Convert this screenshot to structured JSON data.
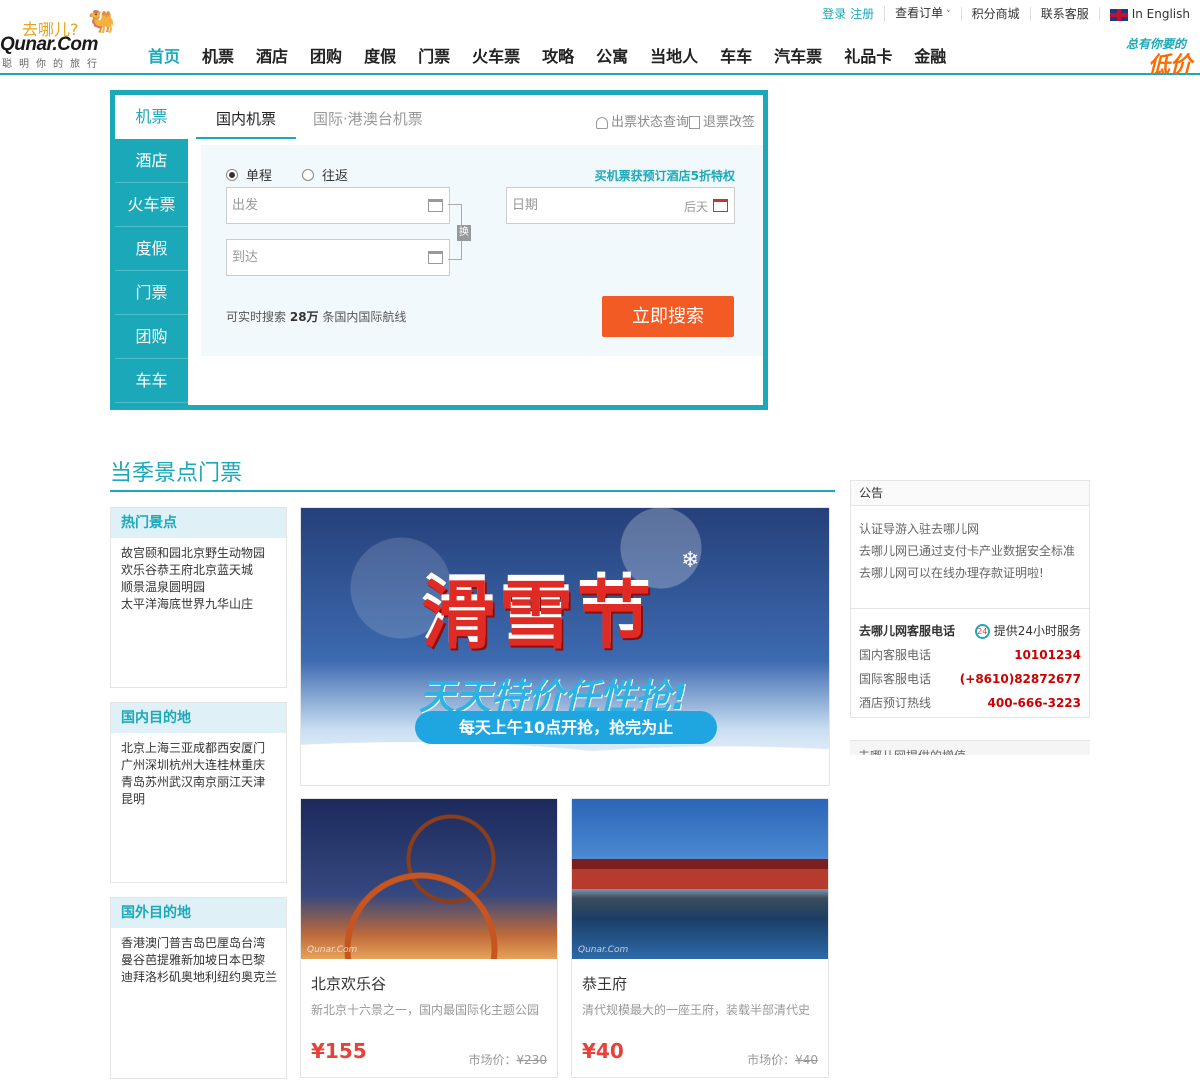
{
  "brand": {
    "logo_cn": "去哪儿?",
    "logo_en": "Qunar.Com",
    "slogan": "聪明你的旅行",
    "promo_line1": "总有你要的",
    "promo_line2": "低价"
  },
  "topbar": {
    "login": "登录",
    "register": "注册",
    "orders": "查看订单",
    "points": "积分商城",
    "service": "联系客服",
    "english": "In English"
  },
  "nav": [
    "首页",
    "机票",
    "酒店",
    "团购",
    "度假",
    "门票",
    "火车票",
    "攻略",
    "公寓",
    "当地人",
    "车车",
    "汽车票",
    "礼品卡",
    "金融"
  ],
  "search": {
    "side_tabs": [
      "机票",
      "酒店",
      "火车票",
      "度假",
      "门票",
      "团购",
      "车车"
    ],
    "tab_domestic": "国内机票",
    "tab_international": "国际·港澳台机票",
    "link_status": "出票状态查询",
    "link_refund": "退票改签",
    "trip_oneway": "单程",
    "trip_round": "往返",
    "deal": "买机票获预订酒店5折特权",
    "from_placeholder": "出发",
    "to_placeholder": "到达",
    "date_placeholder": "日期",
    "date_hint": "后天",
    "swap": "换",
    "stat_prefix": "可实时搜索",
    "stat_count": "28万",
    "stat_suffix": "条国内国际航线",
    "button": "立即搜索"
  },
  "section_title": "当季景点门票",
  "destinations": {
    "hot": {
      "title": "热门景点",
      "items": [
        "故宫",
        "颐和园",
        "北京野生动物园",
        "欢乐谷",
        "恭王府",
        "北京蓝天城",
        "顺景温泉",
        "圆明园",
        "太平洋海底世界",
        "九华山庄"
      ]
    },
    "domestic": {
      "title": "国内目的地",
      "items": [
        "北京",
        "上海",
        "三亚",
        "成都",
        "西安",
        "厦门",
        "广州",
        "深圳",
        "杭州",
        "大连",
        "桂林",
        "重庆",
        "青岛",
        "苏州",
        "武汉",
        "南京",
        "丽江",
        "天津",
        "昆明"
      ]
    },
    "overseas": {
      "title": "国外目的地",
      "items": [
        "香港",
        "澳门",
        "普吉岛",
        "巴厘岛",
        "台湾",
        "曼谷",
        "芭提雅",
        "新加坡",
        "日本",
        "巴黎",
        "迪拜",
        "洛杉矶",
        "奥地利",
        "纽约",
        "奥克兰"
      ]
    }
  },
  "banner": {
    "title": "滑雪节",
    "subtitle": "天天特价任性抢!",
    "pill": "每天上午10点开抢，抢完为止"
  },
  "cards": [
    {
      "name": "北京欢乐谷",
      "desc": "新北京十六景之一，国内最国际化主题公园",
      "price": "¥155",
      "market_label": "市场价：",
      "market_price": "¥230",
      "watermark": "Qunar.Com"
    },
    {
      "name": "恭王府",
      "desc": "清代规模最大的一座王府，装载半部清代史",
      "price": "¥40",
      "market_label": "市场价：",
      "market_price": "¥40",
      "watermark": "Qunar.Com"
    }
  ],
  "notice": {
    "head": "公告",
    "lines": [
      "认证导游入驻去哪儿网",
      "去哪儿网已通过支付卡产业数据安全标准",
      "去哪儿网可以在线办理存款证明啦!"
    ],
    "service_title": "去哪儿网客服电话",
    "service_badge": "提供24小时服务",
    "badge_icon": "24",
    "phones": [
      {
        "label": "国内客服电话",
        "value": "10101234"
      },
      {
        "label": "国际客服电话",
        "value": "(+8610)82872677"
      },
      {
        "label": "酒店预订热线",
        "value": "400-666-3223"
      }
    ],
    "next_head": "去哪儿网提供的增值"
  },
  "colors": {
    "accent": "#1ba9ba",
    "cta": "#f25b23",
    "price": "#e8413a"
  }
}
